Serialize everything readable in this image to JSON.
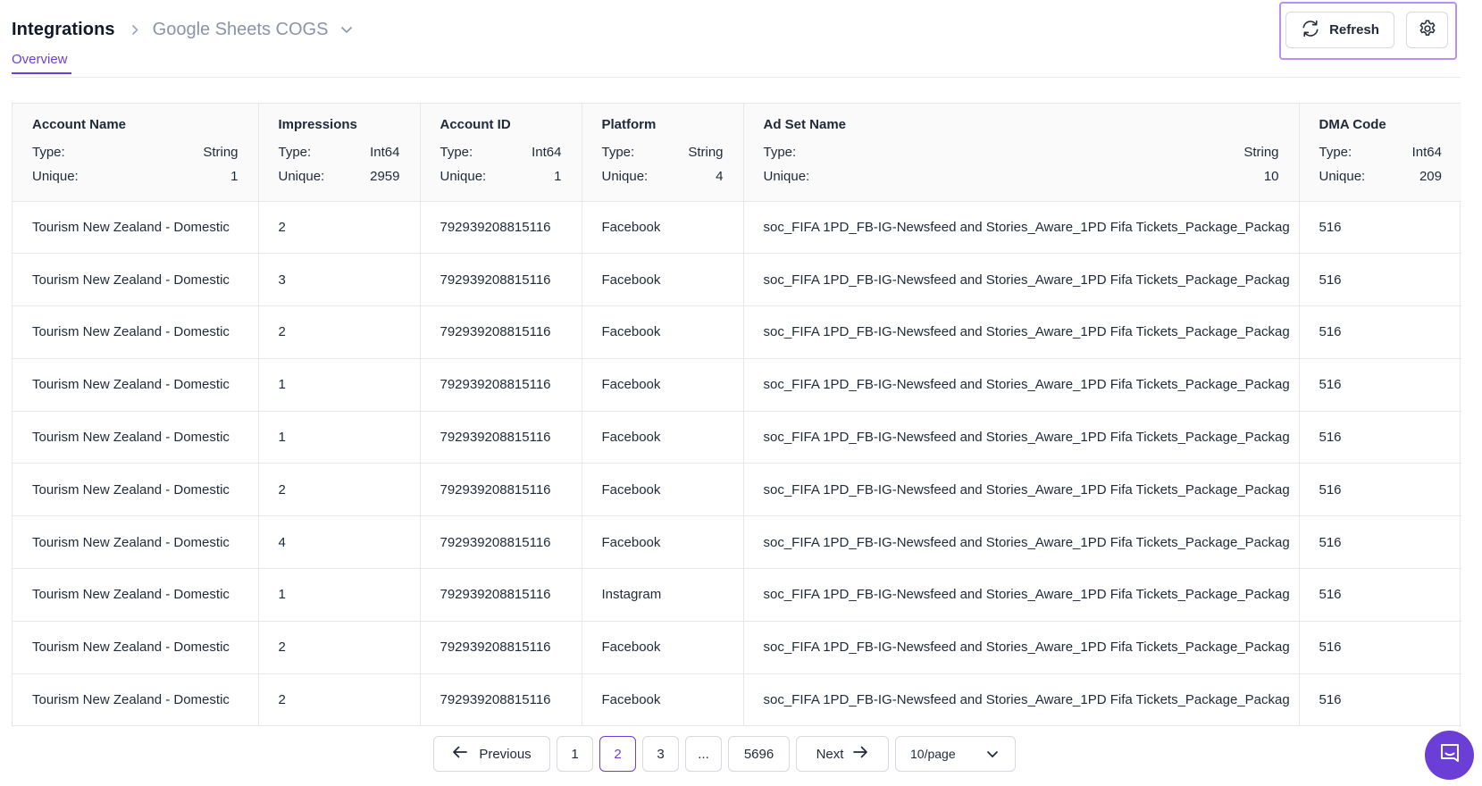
{
  "breadcrumb": {
    "root": "Integrations",
    "current": "Google Sheets COGS"
  },
  "tabs": [
    {
      "label": "Overview",
      "active": true
    }
  ],
  "actions": {
    "refresh_label": "Refresh",
    "settings_icon": "gear-icon"
  },
  "table": {
    "type_label": "Type:",
    "unique_label": "Unique:",
    "columns": [
      {
        "name": "Account Name",
        "type": "String",
        "unique": "1"
      },
      {
        "name": "Impressions",
        "type": "Int64",
        "unique": "2959"
      },
      {
        "name": "Account ID",
        "type": "Int64",
        "unique": "1"
      },
      {
        "name": "Platform",
        "type": "String",
        "unique": "4"
      },
      {
        "name": "Ad Set Name",
        "type": "String",
        "unique": "10"
      },
      {
        "name": "DMA Code",
        "type": "Int64",
        "unique": "209"
      }
    ],
    "rows": [
      [
        "Tourism New Zealand - Domestic",
        "2",
        "792939208815116",
        "Facebook",
        "soc_FIFA 1PD_FB-IG-Newsfeed and Stories_Aware_1PD Fifa Tickets_Package_Packag",
        "516"
      ],
      [
        "Tourism New Zealand - Domestic",
        "3",
        "792939208815116",
        "Facebook",
        "soc_FIFA 1PD_FB-IG-Newsfeed and Stories_Aware_1PD Fifa Tickets_Package_Packag",
        "516"
      ],
      [
        "Tourism New Zealand - Domestic",
        "2",
        "792939208815116",
        "Facebook",
        "soc_FIFA 1PD_FB-IG-Newsfeed and Stories_Aware_1PD Fifa Tickets_Package_Packag",
        "516"
      ],
      [
        "Tourism New Zealand - Domestic",
        "1",
        "792939208815116",
        "Facebook",
        "soc_FIFA 1PD_FB-IG-Newsfeed and Stories_Aware_1PD Fifa Tickets_Package_Packag",
        "516"
      ],
      [
        "Tourism New Zealand - Domestic",
        "1",
        "792939208815116",
        "Facebook",
        "soc_FIFA 1PD_FB-IG-Newsfeed and Stories_Aware_1PD Fifa Tickets_Package_Packag",
        "516"
      ],
      [
        "Tourism New Zealand - Domestic",
        "2",
        "792939208815116",
        "Facebook",
        "soc_FIFA 1PD_FB-IG-Newsfeed and Stories_Aware_1PD Fifa Tickets_Package_Packag",
        "516"
      ],
      [
        "Tourism New Zealand - Domestic",
        "4",
        "792939208815116",
        "Facebook",
        "soc_FIFA 1PD_FB-IG-Newsfeed and Stories_Aware_1PD Fifa Tickets_Package_Packag",
        "516"
      ],
      [
        "Tourism New Zealand - Domestic",
        "1",
        "792939208815116",
        "Instagram",
        "soc_FIFA 1PD_FB-IG-Newsfeed and Stories_Aware_1PD Fifa Tickets_Package_Packag",
        "516"
      ],
      [
        "Tourism New Zealand - Domestic",
        "2",
        "792939208815116",
        "Facebook",
        "soc_FIFA 1PD_FB-IG-Newsfeed and Stories_Aware_1PD Fifa Tickets_Package_Packag",
        "516"
      ],
      [
        "Tourism New Zealand - Domestic",
        "2",
        "792939208815116",
        "Facebook",
        "soc_FIFA 1PD_FB-IG-Newsfeed and Stories_Aware_1PD Fifa Tickets_Package_Packag",
        "516"
      ]
    ]
  },
  "pagination": {
    "previous_label": "Previous",
    "next_label": "Next",
    "pages": [
      "1",
      "2",
      "3",
      "...",
      "5696"
    ],
    "current_page": "2",
    "page_size": "10/page"
  },
  "colors": {
    "accent": "#6b3fd6",
    "highlight_border": "#b88ff3"
  }
}
